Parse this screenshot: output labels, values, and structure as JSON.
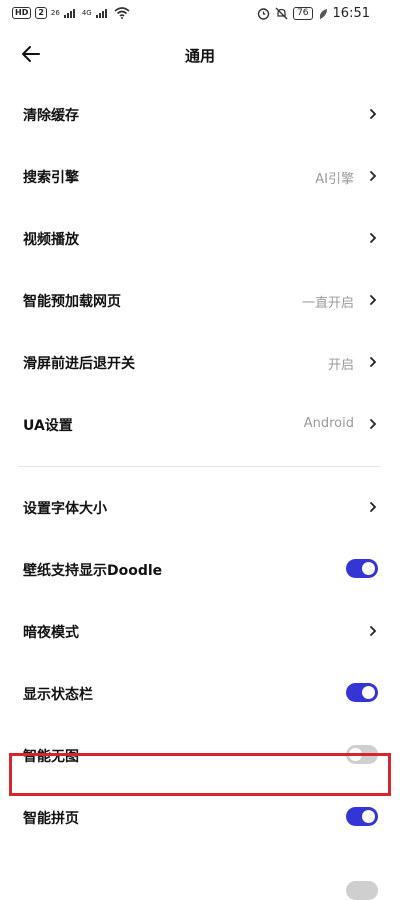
{
  "status_bar": {
    "left_badges": [
      "HD",
      "2"
    ],
    "signal1": "26",
    "signal2": "4G",
    "battery": "76",
    "time": "16:51",
    "icons": [
      "alarm-icon",
      "mute-icon",
      "leaf-icon",
      "wifi-icon"
    ]
  },
  "header": {
    "title": "通用"
  },
  "group1": [
    {
      "label": "清除缓存",
      "value": "",
      "control": "chevron"
    },
    {
      "label": "搜索引擎",
      "value": "AI引擎",
      "control": "chevron"
    },
    {
      "label": "视频播放",
      "value": "",
      "control": "chevron"
    },
    {
      "label": "智能预加载网页",
      "value": "一直开启",
      "control": "chevron"
    },
    {
      "label": "滑屏前进后退开关",
      "value": "开启",
      "control": "chevron"
    },
    {
      "label": "UA设置",
      "value": "Android",
      "control": "chevron"
    }
  ],
  "group2": [
    {
      "label": "设置字体大小",
      "control": "chevron"
    },
    {
      "label": "壁纸支持显示Doodle",
      "control": "toggle",
      "state": "on"
    },
    {
      "label": "暗夜模式",
      "control": "chevron"
    },
    {
      "label": "显示状态栏",
      "control": "toggle",
      "state": "on"
    },
    {
      "label": "智能无图",
      "control": "toggle",
      "state": "off"
    },
    {
      "label": "智能拼页",
      "control": "toggle",
      "state": "on"
    }
  ],
  "colors": {
    "accent": "#3535d6",
    "toggle_off": "#cfcfcf",
    "highlight": "#d7262b",
    "value_text": "#9a9a9a"
  }
}
